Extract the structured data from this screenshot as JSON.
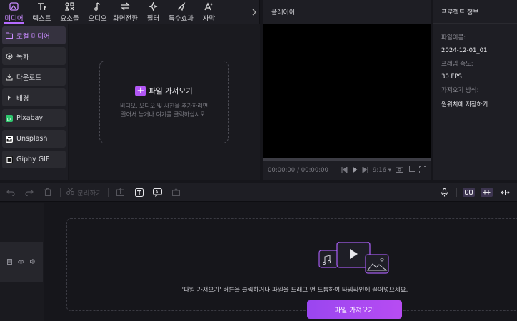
{
  "toolbar": {
    "tabs": [
      {
        "label": "미디어",
        "icon": "media-icon"
      },
      {
        "label": "텍스트",
        "icon": "text-icon"
      },
      {
        "label": "요소들",
        "icon": "elements-icon"
      },
      {
        "label": "오디오",
        "icon": "audio-icon"
      },
      {
        "label": "화면전환",
        "icon": "transition-icon"
      },
      {
        "label": "필터",
        "icon": "filter-icon"
      },
      {
        "label": "특수효과",
        "icon": "effects-icon"
      },
      {
        "label": "자막",
        "icon": "caption-icon"
      }
    ],
    "more_icon": "chevron-right-icon"
  },
  "sidebar": {
    "items": [
      {
        "label": "로컬 미디어",
        "icon": "folder-icon"
      },
      {
        "label": "녹화",
        "icon": "record-icon"
      },
      {
        "label": "다운로드",
        "icon": "download-icon"
      },
      {
        "label": "배경",
        "icon": "caret-right-icon"
      },
      {
        "label": "Pixabay",
        "icon": "pixabay-icon"
      },
      {
        "label": "Unsplash",
        "icon": "unsplash-icon"
      },
      {
        "label": "Giphy GIF",
        "icon": "giphy-icon"
      }
    ]
  },
  "media": {
    "import_label": "파일 가져오기",
    "hint_line1": "비디오, 오디오 및 사진을 추가하려면",
    "hint_line2": "끌어서 놓거나 여기를 클릭하십시오."
  },
  "player": {
    "title": "플레이어",
    "time_current": "00:00:00",
    "time_total": "/ 00:00:00",
    "aspect": "9:16"
  },
  "project": {
    "title": "프로젝트 정보",
    "fields": [
      {
        "label": "파일이름:",
        "value": "2024-12-01_01"
      },
      {
        "label": "프레임 속도:",
        "value": "30 FPS"
      },
      {
        "label": "가져오기 방식:",
        "value": "원위치에 저장하기"
      }
    ]
  },
  "timeline_toolbar": {
    "split_label": "분리하기"
  },
  "timeline": {
    "hint": "'파일 가져오기' 버튼을 클릭하거나 파일을 드래그 앤 드롭하여 타임라인에 끌어넣으세요.",
    "import_button": "파일 가져오기"
  },
  "colors": {
    "accent": "#b56bff",
    "button": "#a64cf2"
  }
}
